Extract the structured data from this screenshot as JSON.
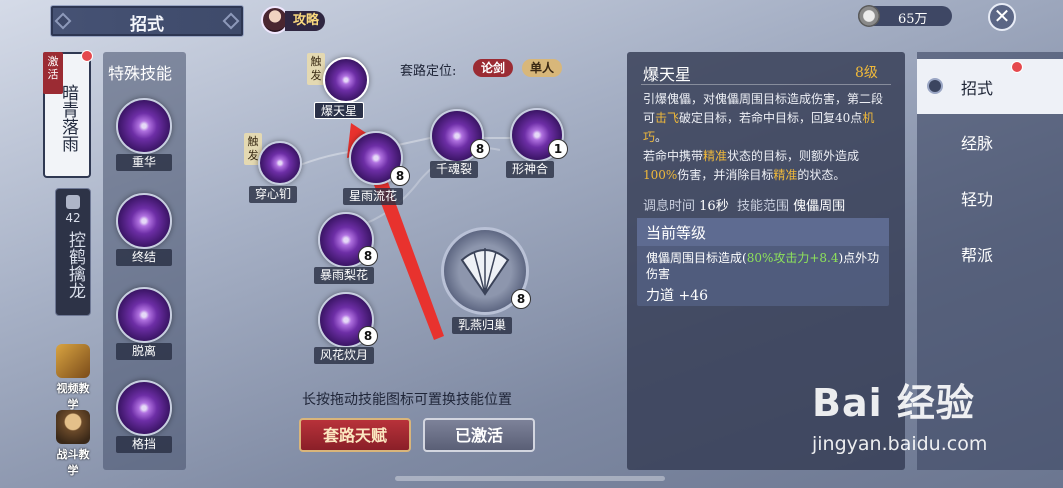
{
  "header": {
    "title": "招式",
    "guide_label": "攻略",
    "currency_value": "65万"
  },
  "left_tabs": {
    "active_badge": "激活",
    "active_label": "暗青落雨",
    "locked_level": "42",
    "locked_label": "控鹤擒龙"
  },
  "tutorials": {
    "video": "视频教学",
    "combat": "战斗教学"
  },
  "special_skills": {
    "title": "特殊技能",
    "items": [
      {
        "label": "重华"
      },
      {
        "label": "终结"
      },
      {
        "label": "脱离"
      },
      {
        "label": "格挡"
      }
    ]
  },
  "route": {
    "label": "套路定位:",
    "tag1": "论剑",
    "tag2": "单人"
  },
  "trigger_label": "触发",
  "skill_tree": {
    "baotianxing": {
      "label": "爆天星"
    },
    "chuanxindiao": {
      "label": "穿心钔"
    },
    "xingyuliuhua": {
      "label": "星雨流花",
      "badge": "8"
    },
    "qianhunlie": {
      "label": "千魂裂",
      "badge": "8"
    },
    "xingshenhe": {
      "label": "形神合",
      "badge": "1"
    },
    "baoyulihua": {
      "label": "暴雨梨花",
      "badge": "8"
    },
    "fenghuachuiyue": {
      "label": "风花炊月",
      "badge": "8"
    },
    "ruyanguichao": {
      "label": "乳燕归巢",
      "badge": "8"
    }
  },
  "hint": "长按拖动技能图标可置换技能位置",
  "buttons": {
    "talent": "套路天赋",
    "activated": "已激活"
  },
  "detail": {
    "name": "爆天星",
    "level": "8级",
    "desc": {
      "p1": "引爆傀儡，对傀儡周围目标造成伤害，第二段可",
      "k1": "击飞",
      "p2": "破定目标，若命中目标，回复40点",
      "k2": "机巧",
      "p3": "。",
      "p4": "若命中携带",
      "k3": "精准",
      "p5": "状态的目标，则额外造成",
      "k4": "100%",
      "p6": "伤害，并消除目标",
      "k5": "精准",
      "p7": "的状态。"
    },
    "cooldown_label": "调息时间",
    "cooldown_value": "16秒",
    "range_label": "技能范围",
    "range_value": "傀儡周围",
    "current_level_title": "当前等级",
    "effect_prefix": "傀儡周围目标造成(",
    "effect_highlight": "80%攻击力+8.4",
    "effect_suffix": ")点外功伤害",
    "stat_label": "力道",
    "stat_value": "+46"
  },
  "right_nav": {
    "items": [
      {
        "label": "招式"
      },
      {
        "label": "经脉"
      },
      {
        "label": "轻功"
      },
      {
        "label": "帮派"
      }
    ]
  },
  "watermark": {
    "brand": "Bai 经验",
    "url": "jingyan.baidu.com"
  },
  "colors": {
    "accent_gold": "#f0b93a",
    "highlight_green": "#8ee35a",
    "arrow_red": "#e8322e",
    "badge_red": "#9b2b33"
  }
}
